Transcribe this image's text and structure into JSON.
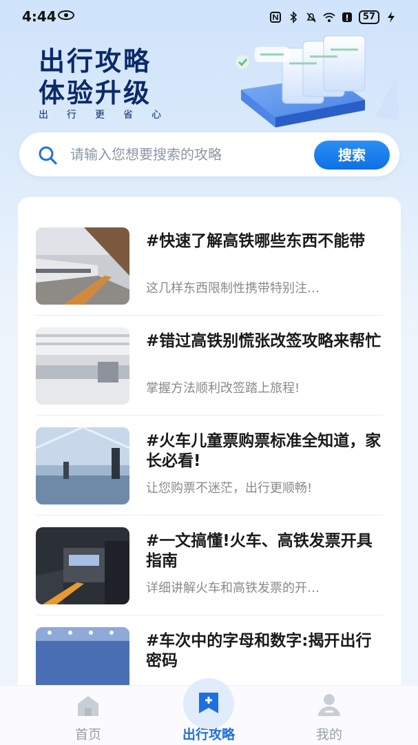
{
  "status_bar": {
    "time": "4:44",
    "battery": "57"
  },
  "hero": {
    "title_line1": "出行攻略",
    "title_line2": "体验升级",
    "subtitle": "出行更省心"
  },
  "search": {
    "placeholder": "请输入您想要搜索的攻略",
    "button_label": "搜索"
  },
  "articles": [
    {
      "title": "#快速了解高铁哪些东西不能带",
      "desc": "这几样东西限制性携带特别注…"
    },
    {
      "title": "#错过高铁别慌张改签攻略来帮忙",
      "desc": "掌握方法顺利改签踏上旅程!"
    },
    {
      "title": "#火车儿童票购票标准全知道，家长必看!",
      "desc": "让您购票不迷茫，出行更顺畅!"
    },
    {
      "title": "#一文搞懂!火车、高铁发票开具指南",
      "desc": "详细讲解火车和高铁发票的开…"
    },
    {
      "title": "#车次中的字母和数字:揭开出行密码",
      "desc": ""
    }
  ],
  "nav": {
    "home_label": "首页",
    "guide_label": "出行攻略",
    "mine_label": "我的"
  },
  "colors": {
    "accent": "#1e6fe0",
    "title": "#0b2a6b"
  }
}
